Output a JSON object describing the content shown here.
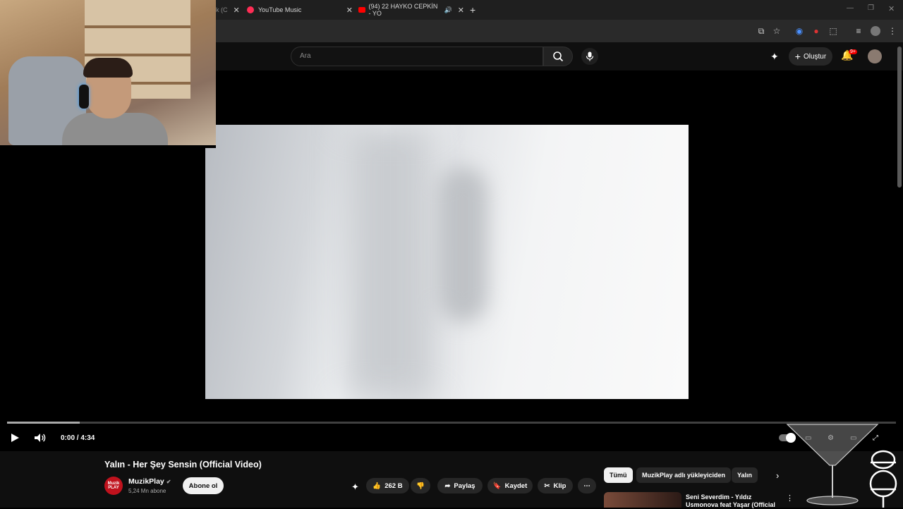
{
  "browser": {
    "tabs": [
      {
        "label": "YouTube Music"
      },
      {
        "label": "(94) 22 HAYKO CEPKİN - YO"
      }
    ],
    "new_tab": "+",
    "partial_tab_label": "k (C"
  },
  "header": {
    "search_placeholder": "Ara",
    "create_label": "Oluştur",
    "notif_count": "9+"
  },
  "player": {
    "time": "0:00 / 4:34",
    "progress": 0.0,
    "buffered": 0.082
  },
  "video": {
    "title": "Yalın - Her Şey Sensin (Official Video)",
    "channel": "MuzikPlay",
    "channel_logo_text": "Muzik PLAY",
    "subscribers": "5,24 Mn abone",
    "subscribe_label": "Abone ol",
    "likes": "262 B",
    "share_label": "Paylaş",
    "save_label": "Kaydet",
    "clip_label": "Klip"
  },
  "sidebar": {
    "chips": [
      "Tümü",
      "MuzikPlay adlı yükleyiciden",
      "Yalın"
    ],
    "next_title": "Seni Severdim - Yıldız Usmonova feat Yaşar (Official"
  },
  "colors": {
    "accent": "#ff0000",
    "background": "#0f0f0f",
    "chip_bg": "#272727"
  }
}
